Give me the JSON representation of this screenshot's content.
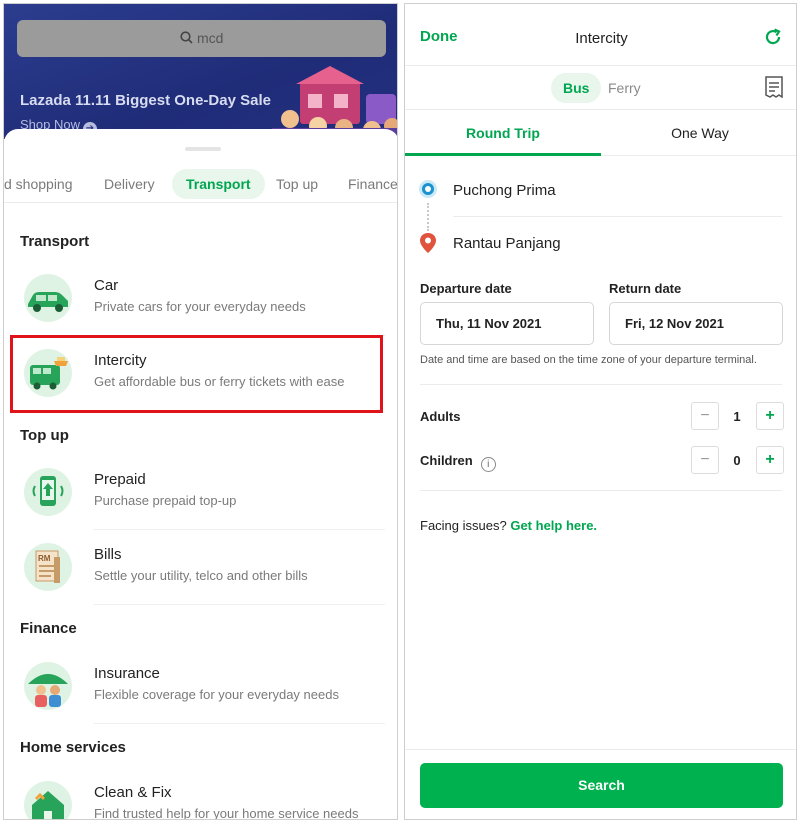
{
  "left": {
    "banner": {
      "search_query": "mcd",
      "title": "Lazada 11.11 Biggest One-Day Sale",
      "subtitle": "Shop Now"
    },
    "tabs": [
      {
        "label": "d shopping"
      },
      {
        "label": "Delivery"
      },
      {
        "label": "Transport"
      },
      {
        "label": "Top up"
      },
      {
        "label": "Finance"
      }
    ],
    "active_tab": "Transport",
    "sections": {
      "transport": {
        "title": "Transport",
        "items": [
          {
            "name": "Car",
            "desc": "Private cars for your everyday needs",
            "icon": "car-icon"
          },
          {
            "name": "Intercity",
            "desc": "Get affordable bus or ferry tickets with ease",
            "icon": "bus-icon"
          }
        ]
      },
      "topup": {
        "title": "Top up",
        "items": [
          {
            "name": "Prepaid",
            "desc": "Purchase prepaid top-up",
            "icon": "phone-topup-icon"
          },
          {
            "name": "Bills",
            "desc": "Settle your utility, telco and other bills",
            "icon": "bill-icon"
          }
        ]
      },
      "finance": {
        "title": "Finance",
        "items": [
          {
            "name": "Insurance",
            "desc": "Flexible coverage for your everyday needs",
            "icon": "insurance-umbrella-icon"
          }
        ]
      },
      "home": {
        "title": "Home services",
        "items": [
          {
            "name": "Clean & Fix",
            "desc": "Find trusted help for your home service needs",
            "icon": "house-tools-icon"
          }
        ]
      }
    },
    "colors": {
      "highlight": "#e0131b",
      "accent": "#00a650",
      "banner": "#24307f"
    }
  },
  "right": {
    "header": {
      "done": "Done",
      "title": "Intercity"
    },
    "modes": {
      "bus": "Bus",
      "ferry": "Ferry",
      "active": "Bus"
    },
    "trip_tabs": {
      "round": "Round Trip",
      "oneway": "One Way",
      "active": "Round Trip"
    },
    "origin": "Puchong Prima",
    "destination": "Rantau Panjang",
    "departure": {
      "label": "Departure date",
      "value": "Thu, 11 Nov 2021"
    },
    "return": {
      "label": "Return date",
      "value": "Fri, 12 Nov 2021"
    },
    "timezone_note": "Date and time are based on the time zone of your departure terminal.",
    "passengers": {
      "adults": {
        "label": "Adults",
        "count": "1"
      },
      "children": {
        "label": "Children",
        "count": "0"
      }
    },
    "stepper": {
      "minus": "−",
      "plus": "+"
    },
    "help": {
      "prefix": "Facing issues?",
      "link": "Get help here."
    },
    "search_button": "Search",
    "colors": {
      "primary": "#00b14f",
      "origin": "#1a93d0",
      "destination": "#e0533d"
    }
  }
}
